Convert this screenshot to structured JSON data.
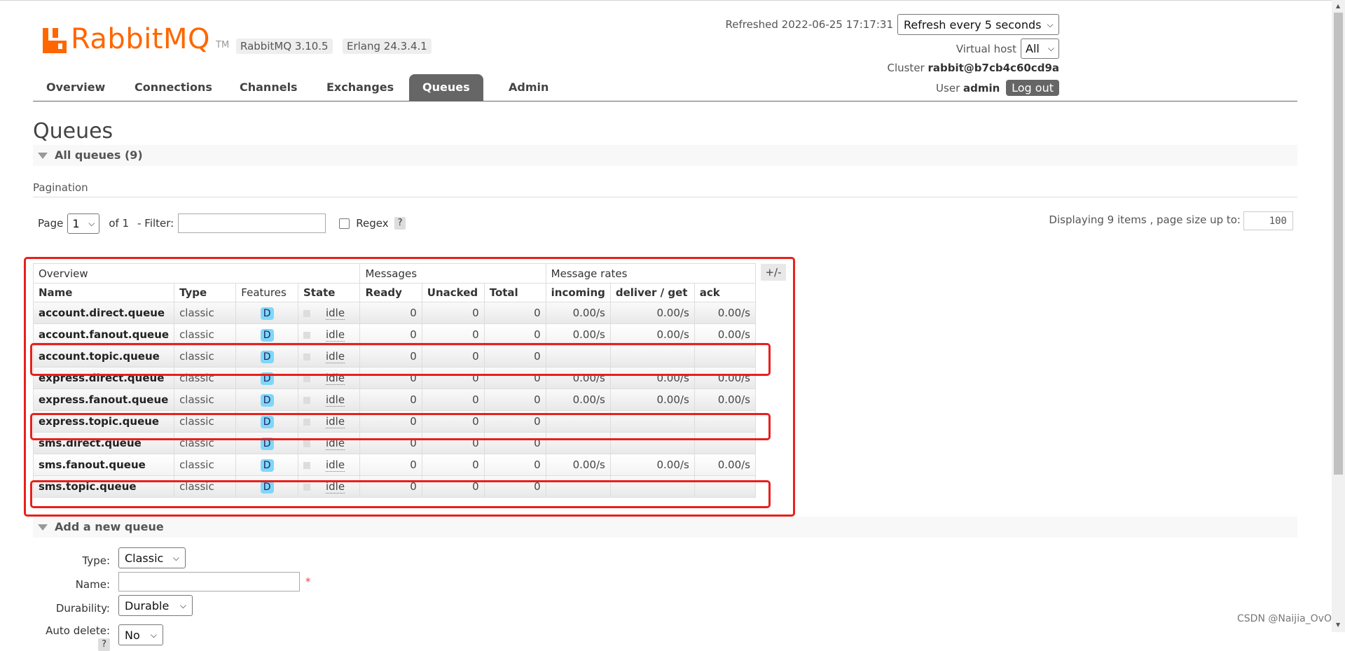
{
  "header": {
    "app_name": "RabbitMQ",
    "tm": "TM",
    "versions": [
      "RabbitMQ 3.10.5",
      "Erlang 24.3.4.1"
    ],
    "refreshed": "Refreshed 2022-06-25 17:17:31",
    "refresh_select": "Refresh every 5 seconds",
    "vhost_label": "Virtual host",
    "vhost_value": "All",
    "cluster_label": "Cluster",
    "cluster_value": "rabbit@b7cb4c60cd9a",
    "user_label": "User",
    "user_value": "admin",
    "logout": "Log out"
  },
  "nav": {
    "tabs": [
      "Overview",
      "Connections",
      "Channels",
      "Exchanges",
      "Queues",
      "Admin"
    ],
    "active": "Queues"
  },
  "page": {
    "title": "Queues",
    "all_queues": "All queues (9)",
    "pagination": "Pagination"
  },
  "pager": {
    "page_label": "Page",
    "page_value": "1",
    "of_label": "of 1",
    "filter_label": "- Filter:",
    "filter_value": "",
    "regex_label": "Regex",
    "help": "?",
    "display_info": "Displaying 9 items , page size up to:",
    "page_size": "100"
  },
  "table": {
    "groups": [
      "Overview",
      "Messages",
      "Message rates"
    ],
    "columns": [
      "Name",
      "Type",
      "Features",
      "State",
      "Ready",
      "Unacked",
      "Total",
      "incoming",
      "deliver / get",
      "ack"
    ],
    "plus_minus": "+/-",
    "rows": [
      {
        "name": "account.direct.queue",
        "type": "classic",
        "feature": "D",
        "state": "idle",
        "ready": "0",
        "unacked": "0",
        "total": "0",
        "incoming": "0.00/s",
        "deliver": "0.00/s",
        "ack": "0.00/s"
      },
      {
        "name": "account.fanout.queue",
        "type": "classic",
        "feature": "D",
        "state": "idle",
        "ready": "0",
        "unacked": "0",
        "total": "0",
        "incoming": "0.00/s",
        "deliver": "0.00/s",
        "ack": "0.00/s"
      },
      {
        "name": "account.topic.queue",
        "type": "classic",
        "feature": "D",
        "state": "idle",
        "ready": "0",
        "unacked": "0",
        "total": "0",
        "incoming": "",
        "deliver": "",
        "ack": ""
      },
      {
        "name": "express.direct.queue",
        "type": "classic",
        "feature": "D",
        "state": "idle",
        "ready": "0",
        "unacked": "0",
        "total": "0",
        "incoming": "0.00/s",
        "deliver": "0.00/s",
        "ack": "0.00/s"
      },
      {
        "name": "express.fanout.queue",
        "type": "classic",
        "feature": "D",
        "state": "idle",
        "ready": "0",
        "unacked": "0",
        "total": "0",
        "incoming": "0.00/s",
        "deliver": "0.00/s",
        "ack": "0.00/s"
      },
      {
        "name": "express.topic.queue",
        "type": "classic",
        "feature": "D",
        "state": "idle",
        "ready": "0",
        "unacked": "0",
        "total": "0",
        "incoming": "",
        "deliver": "",
        "ack": ""
      },
      {
        "name": "sms.direct.queue",
        "type": "classic",
        "feature": "D",
        "state": "idle",
        "ready": "0",
        "unacked": "0",
        "total": "0",
        "incoming": "",
        "deliver": "",
        "ack": ""
      },
      {
        "name": "sms.fanout.queue",
        "type": "classic",
        "feature": "D",
        "state": "idle",
        "ready": "0",
        "unacked": "0",
        "total": "0",
        "incoming": "0.00/s",
        "deliver": "0.00/s",
        "ack": "0.00/s"
      },
      {
        "name": "sms.topic.queue",
        "type": "classic",
        "feature": "D",
        "state": "idle",
        "ready": "0",
        "unacked": "0",
        "total": "0",
        "incoming": "",
        "deliver": "",
        "ack": ""
      }
    ]
  },
  "add_queue": {
    "title": "Add a new queue",
    "type_label": "Type:",
    "type_value": "Classic",
    "name_label": "Name:",
    "name_value": "",
    "required": "*",
    "durability_label": "Durability:",
    "durability_value": "Durable",
    "autodelete_label": "Auto delete:",
    "autodelete_help": "?",
    "autodelete_value": "No"
  },
  "watermark": "CSDN @Naijia_OvO",
  "colors": {
    "brand": "#ff6600",
    "highlight": "#e8201c",
    "badge": "#7fd7f7"
  }
}
